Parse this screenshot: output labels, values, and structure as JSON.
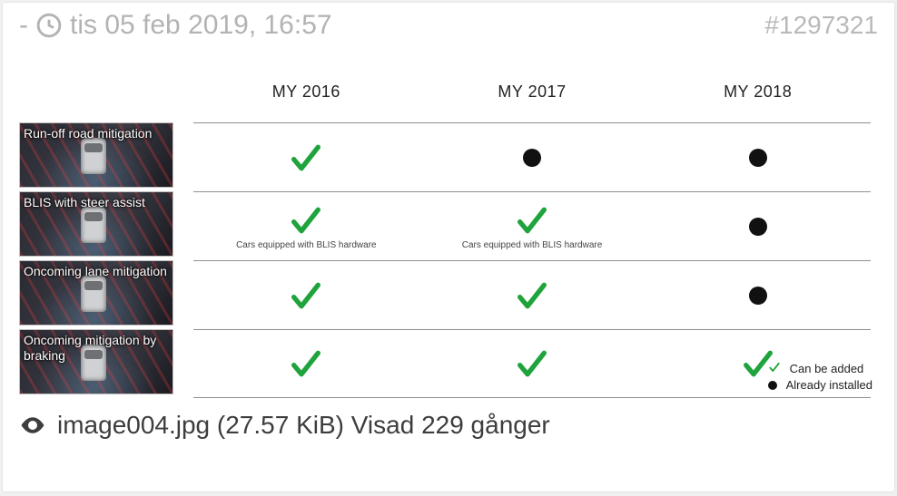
{
  "header": {
    "dash": "-",
    "datetime": "tis 05 feb 2019, 16:57",
    "post_id": "#1297321"
  },
  "chart_data": {
    "type": "table",
    "columns": [
      "MY 2016",
      "MY 2017",
      "MY 2018"
    ],
    "rows": [
      {
        "label": "Run-off road mitigation",
        "cells": [
          {
            "state": "check"
          },
          {
            "state": "dot"
          },
          {
            "state": "dot"
          }
        ]
      },
      {
        "label": "BLIS with steer assist",
        "cells": [
          {
            "state": "check",
            "note": "Cars equipped with BLIS hardware"
          },
          {
            "state": "check",
            "note": "Cars equipped with BLIS hardware"
          },
          {
            "state": "dot"
          }
        ]
      },
      {
        "label": "Oncoming lane mitigation",
        "cells": [
          {
            "state": "check"
          },
          {
            "state": "check"
          },
          {
            "state": "dot"
          }
        ]
      },
      {
        "label": "Oncoming mitigation by braking",
        "cells": [
          {
            "state": "check"
          },
          {
            "state": "check"
          },
          {
            "state": "check"
          }
        ]
      }
    ],
    "legend": [
      {
        "symbol": "check",
        "text": "Can be added"
      },
      {
        "symbol": "dot",
        "text": "Already installed"
      }
    ]
  },
  "caption": {
    "text": "image004.jpg (27.57 KiB) Visad 229 gånger"
  },
  "colors": {
    "check": "#1fa33c",
    "dot": "#111111",
    "muted": "#b3b3b3"
  }
}
